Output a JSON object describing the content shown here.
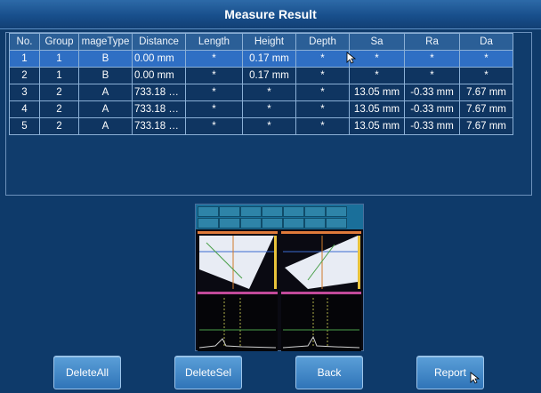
{
  "window": {
    "title": "Measure Result"
  },
  "table": {
    "columns": [
      "No.",
      "Group",
      "mageType",
      "Distance",
      "Length",
      "Height",
      "Depth",
      "Sa",
      "Ra",
      "Da"
    ],
    "rows": [
      {
        "selected": true,
        "cells": [
          "1",
          "1",
          "B",
          "0.00 mm",
          "*",
          "0.17 mm",
          "*",
          "*",
          "*",
          "*"
        ]
      },
      {
        "selected": false,
        "cells": [
          "2",
          "1",
          "B",
          "0.00 mm",
          "*",
          "0.17 mm",
          "*",
          "*",
          "*",
          "*"
        ]
      },
      {
        "selected": false,
        "cells": [
          "3",
          "2",
          "A",
          "733.18 …",
          "*",
          "*",
          "*",
          "13.05 mm",
          "-0.33 mm",
          "7.67 mm"
        ]
      },
      {
        "selected": false,
        "cells": [
          "4",
          "2",
          "A",
          "733.18 …",
          "*",
          "*",
          "*",
          "13.05 mm",
          "-0.33 mm",
          "7.67 mm"
        ]
      },
      {
        "selected": false,
        "cells": [
          "5",
          "2",
          "A",
          "733.18 …",
          "*",
          "*",
          "*",
          "13.05 mm",
          "-0.33 mm",
          "7.67 mm"
        ]
      }
    ]
  },
  "preview": {
    "icon": "report-thumbnail"
  },
  "buttons": {
    "delete_all": "DeleteAll",
    "delete_sel": "DeleteSel",
    "back": "Back",
    "report": "Report"
  },
  "colors": {
    "background": "#0e3a6a",
    "selected_row": "#2f6fc4",
    "button": "#3f86c8"
  }
}
